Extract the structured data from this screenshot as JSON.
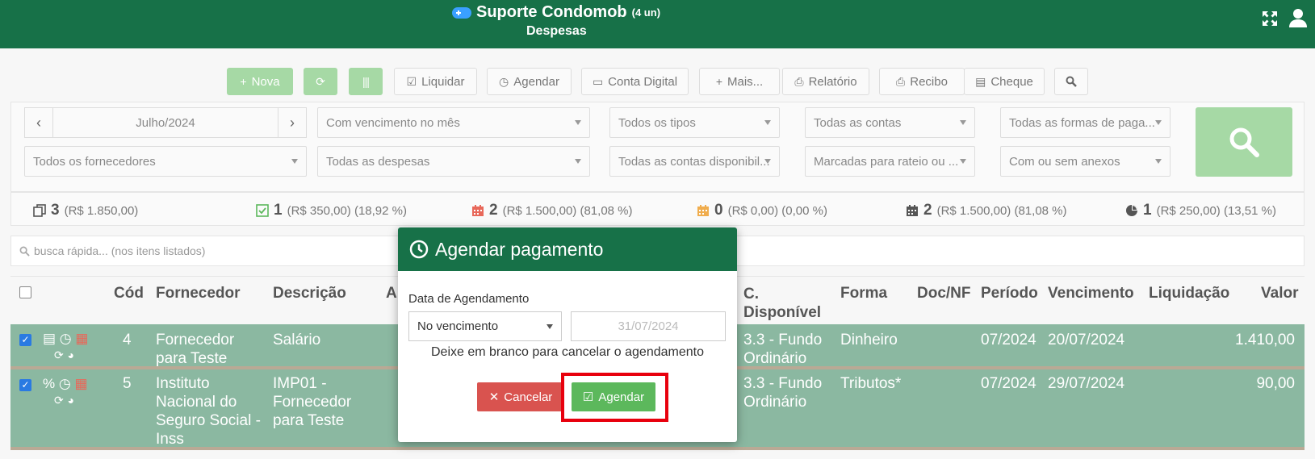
{
  "header": {
    "app_title": "Suporte Condomob",
    "units": "(4 un)",
    "subtitle": "Despesas",
    "icons": [
      "gamepad-icon",
      "expand-icon",
      "user-icon"
    ]
  },
  "toolbar": {
    "nova": "Nova",
    "liquidar": "Liquidar",
    "agendar": "Agendar",
    "conta_digital": "Conta Digital",
    "mais": "Mais...",
    "relatorio": "Relatório",
    "recibo": "Recibo",
    "cheque": "Cheque"
  },
  "filters": {
    "month": "Julho/2024",
    "vencimento": "Com vencimento no mês",
    "tipos": "Todos os tipos",
    "contas": "Todas as contas",
    "formas": "Todas as formas de paga...",
    "fornecedores": "Todos os fornecedores",
    "despesas": "Todas as despesas",
    "contas_disp": "Todas as contas disponibil...",
    "rateio": "Marcadas para rateio ou ...",
    "anexos": "Com ou sem anexos"
  },
  "stats": [
    {
      "count": "3",
      "detail": "(R$ 1.850,00)",
      "icon": "copy-icon",
      "color": "#555555"
    },
    {
      "count": "1",
      "detail": "(R$ 350,00) (18,92 %)",
      "icon": "check-square-icon",
      "color": "#5cb85c"
    },
    {
      "count": "2",
      "detail": "(R$ 1.500,00) (81,08 %)",
      "icon": "calendar-icon",
      "color": "#e8685a"
    },
    {
      "count": "0",
      "detail": "(R$ 0,00) (0,00 %)",
      "icon": "calendar-icon",
      "color": "#f0ad4e"
    },
    {
      "count": "2",
      "detail": "(R$ 1.500,00) (81,08 %)",
      "icon": "calendar-icon",
      "color": "#555555"
    },
    {
      "count": "1",
      "detail": "(R$ 250,00) (13,51 %)",
      "icon": "pie-chart-icon",
      "color": "#555555"
    }
  ],
  "quick_search": {
    "placeholder": "busca rápida... (nos itens listados)"
  },
  "table": {
    "headers": {
      "cod": "Cód",
      "fornecedor": "Fornecedor",
      "descricao": "Descrição",
      "a": "A",
      "cdisp1": "C.",
      "cdisp2": "Disponível",
      "forma": "Forma",
      "docnf": "Doc/NF",
      "periodo": "Período",
      "vencimento": "Vencimento",
      "liquidacao": "Liquidação",
      "valor": "Valor"
    },
    "rows": [
      {
        "cod": "4",
        "fornecedor1": "Fornecedor",
        "fornecedor2": "para Teste",
        "descricao1": "Salário",
        "descricao2": "",
        "descricao3": "",
        "cdisp1": "3.3 - Fundo",
        "cdisp2": "Ordinário",
        "forma": "Dinheiro",
        "periodo": "07/2024",
        "vencimento": "20/07/2024",
        "valor": "1.410,00"
      },
      {
        "cod": "5",
        "fornecedor1": "Instituto",
        "fornecedor2": "Nacional do",
        "fornecedor3": "Seguro Social -",
        "fornecedor4": "Inss",
        "descricao1": "IMP01 -",
        "descricao2": "Fornecedor",
        "descricao3": "para Teste",
        "cdisp1": "3.3 - Fundo",
        "cdisp2": "Ordinário",
        "forma": "Tributos*",
        "periodo": "07/2024",
        "vencimento": "29/07/2024",
        "valor": "90,00"
      }
    ]
  },
  "modal": {
    "title": "Agendar pagamento",
    "label": "Data de Agendamento",
    "select_value": "No vencimento",
    "date_value": "31/07/2024",
    "help": "Deixe em branco para cancelar o agendamento",
    "cancel": "Cancelar",
    "confirm": "Agendar"
  }
}
